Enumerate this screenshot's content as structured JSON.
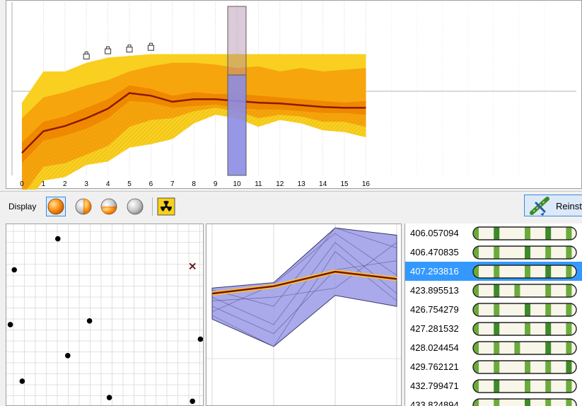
{
  "toolbar": {
    "display_label": "Display",
    "reinstall_label": "Reinst",
    "display_modes": [
      "orange-sphere",
      "orange-half-sphere",
      "orange-gray-sphere",
      "gray-sphere"
    ],
    "radiation_icon": "radiation-icon"
  },
  "colors": {
    "outer_band": "#f9d020",
    "mid_band": "#f7a50c",
    "inner_band": "#f28a00",
    "median_line": "#8b1a00",
    "highlight_column": "#8c8ce6",
    "selection_bg": "#3399ff",
    "chromosome_green": "#6aab3c"
  },
  "chart_data": {
    "type": "area",
    "x": [
      0,
      1,
      2,
      3,
      4,
      5,
      6,
      7,
      8,
      9,
      10,
      11,
      12,
      13,
      14,
      15,
      16
    ],
    "x_tick_labels": [
      "0",
      "1",
      "2",
      "3",
      "4",
      "5",
      "6",
      "7",
      "8",
      "9",
      "10",
      "11",
      "12",
      "13",
      "14",
      "15",
      "16"
    ],
    "xlim": [
      0,
      16
    ],
    "grid": true,
    "highlighted_x": 10,
    "marker_x": [
      3,
      4,
      5,
      6
    ],
    "series": [
      {
        "values": [
          0.42,
          0.6,
          0.6,
          0.65,
          0.68,
          0.69,
          0.7,
          0.7,
          0.7,
          0.7,
          0.7,
          0.7,
          0.7,
          0.7,
          0.7,
          0.7,
          0.7
        ]
      },
      {
        "values": [
          0.33,
          0.45,
          0.48,
          0.52,
          0.55,
          0.6,
          0.63,
          0.65,
          0.65,
          0.64,
          0.62,
          0.63,
          0.6,
          0.62,
          0.6,
          0.61,
          0.62
        ]
      },
      {
        "values": [
          0.19,
          0.31,
          0.34,
          0.39,
          0.44,
          0.52,
          0.5,
          0.46,
          0.48,
          0.47,
          0.47,
          0.46,
          0.45,
          0.44,
          0.43,
          0.42,
          0.43
        ]
      },
      {
        "values": [
          0.07,
          0.2,
          0.23,
          0.27,
          0.33,
          0.43,
          0.42,
          0.39,
          0.4,
          0.41,
          0.39,
          0.38,
          0.38,
          0.37,
          0.36,
          0.36,
          0.35
        ]
      },
      {
        "values": [
          -0.12,
          0.05,
          0.07,
          0.12,
          0.17,
          0.28,
          0.32,
          0.33,
          0.37,
          0.39,
          0.37,
          0.33,
          0.35,
          0.34,
          0.31,
          0.31,
          0.28
        ]
      },
      {
        "values": [
          -0.2,
          -0.03,
          -0.01,
          0.06,
          0.08,
          0.16,
          0.18,
          0.21,
          0.3,
          0.35,
          0.33,
          0.28,
          0.32,
          0.3,
          0.26,
          0.25,
          0.22
        ]
      }
    ]
  },
  "scatter": {
    "points": [
      [
        0.26,
        0.08
      ],
      [
        0.04,
        0.25
      ],
      [
        0.02,
        0.55
      ],
      [
        0.42,
        0.53
      ],
      [
        0.31,
        0.72
      ],
      [
        0.08,
        0.86
      ],
      [
        0.52,
        0.95
      ],
      [
        0.94,
        0.97
      ],
      [
        0.98,
        0.63
      ]
    ],
    "cross": [
      0.94,
      0.23
    ]
  },
  "parallel": {
    "axes": 4,
    "highlight": [
      0.38,
      0.34,
      0.26,
      0.3
    ]
  },
  "list": {
    "selected_index": 2,
    "items": [
      {
        "value": "406.057094"
      },
      {
        "value": "406.470835"
      },
      {
        "value": "407.293816"
      },
      {
        "value": "423.895513"
      },
      {
        "value": "426.754279"
      },
      {
        "value": "427.281532"
      },
      {
        "value": "428.024454"
      },
      {
        "value": "429.762121"
      },
      {
        "value": "432.799471"
      },
      {
        "value": "433.824894"
      }
    ]
  }
}
